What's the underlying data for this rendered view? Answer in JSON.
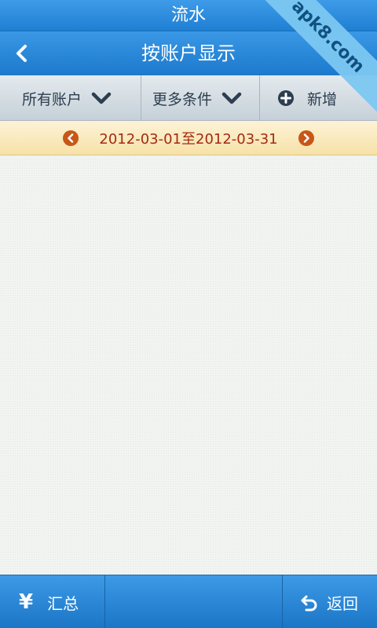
{
  "status": {
    "title": "流水"
  },
  "header": {
    "title": "按账户显示"
  },
  "toolbar": {
    "accounts_label": "所有账户",
    "more_label": "更多条件",
    "add_label": "新增"
  },
  "date_range": {
    "text": "2012-03-01至2012-03-31"
  },
  "bottom": {
    "summary_label": "汇总",
    "return_label": "返回"
  },
  "watermark": {
    "text": "apk8.com"
  },
  "colors": {
    "header_blue": "#1f7fd3",
    "toolbar_gray": "#c6d0d8",
    "date_bar_yellow": "#f6e1a8",
    "date_text_red": "#a32b12",
    "date_arrow_orange": "#c75719"
  }
}
